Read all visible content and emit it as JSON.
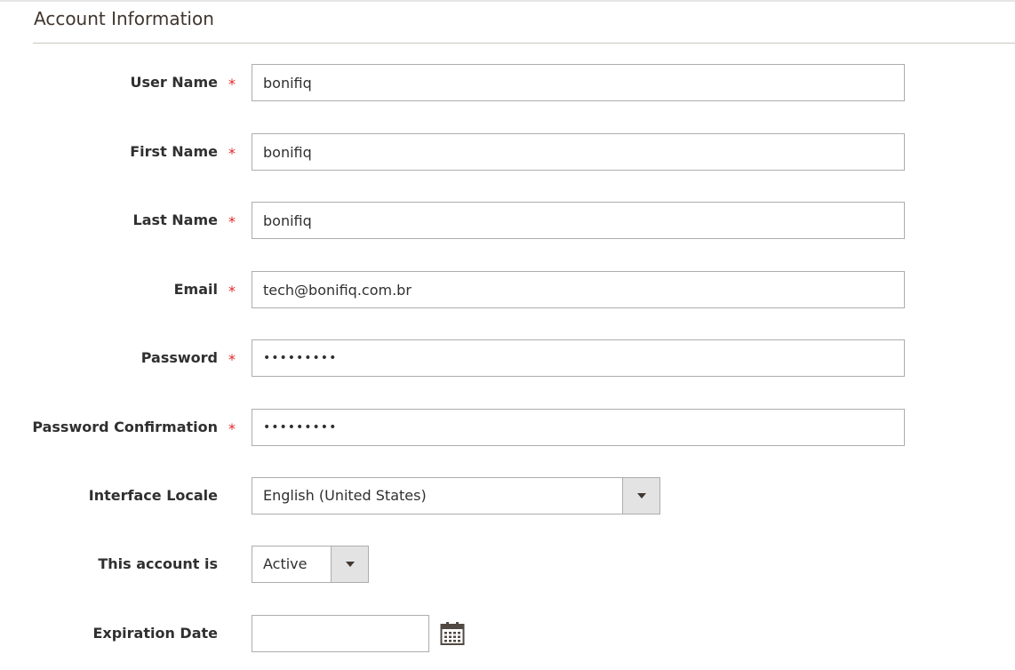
{
  "section": {
    "title": "Account Information"
  },
  "fields": {
    "username": {
      "label": "User Name",
      "required": "*",
      "value": "bonifiq"
    },
    "firstname": {
      "label": "First Name",
      "required": "*",
      "value": "bonifiq"
    },
    "lastname": {
      "label": "Last Name",
      "required": "*",
      "value": "bonifiq"
    },
    "email": {
      "label": "Email",
      "required": "*",
      "value": "tech@bonifiq.com.br"
    },
    "password": {
      "label": "Password",
      "required": "*",
      "value": "•••••••••"
    },
    "password_confirmation": {
      "label": "Password Confirmation",
      "required": "*",
      "value": "•••••••••"
    },
    "interface_locale": {
      "label": "Interface Locale",
      "selected": "English (United States)"
    },
    "account_status": {
      "label": "This account is",
      "selected": "Active"
    },
    "expiration_date": {
      "label": "Expiration Date",
      "value": "",
      "icon": "calendar-icon"
    }
  },
  "colors": {
    "required": "#e22626",
    "border": "#adadad",
    "select_button": "#e3e3e3",
    "title": "#41362f"
  }
}
